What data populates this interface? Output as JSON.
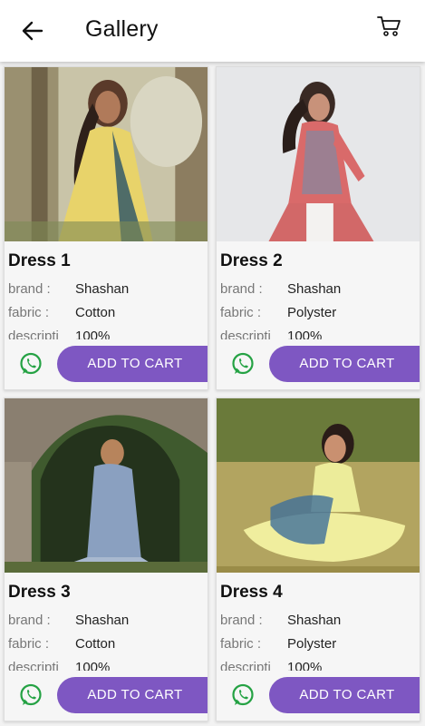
{
  "appbar": {
    "title": "Gallery",
    "back_icon": "arrow-left-icon",
    "cart_icon": "shopping-cart-icon"
  },
  "labels": {
    "brand": "brand :",
    "fabric": "fabric :",
    "description": "descripti",
    "add_to_cart": "ADD TO CART"
  },
  "products": [
    {
      "name": "Dress 1",
      "brand": "Shashan",
      "fabric": "Cotton",
      "description": "100%"
    },
    {
      "name": "Dress 2",
      "brand": "Shashan",
      "fabric": "Polyster",
      "description": "100%"
    },
    {
      "name": "Dress 3",
      "brand": "Shashan",
      "fabric": "Cotton",
      "description": "100%"
    },
    {
      "name": "Dress 4",
      "brand": "Shashan",
      "fabric": "Polyster",
      "description": "100%"
    }
  ],
  "colors": {
    "accent": "#7e57c2",
    "whatsapp": "#25a244"
  },
  "icons": {
    "share": "whatsapp-icon"
  }
}
